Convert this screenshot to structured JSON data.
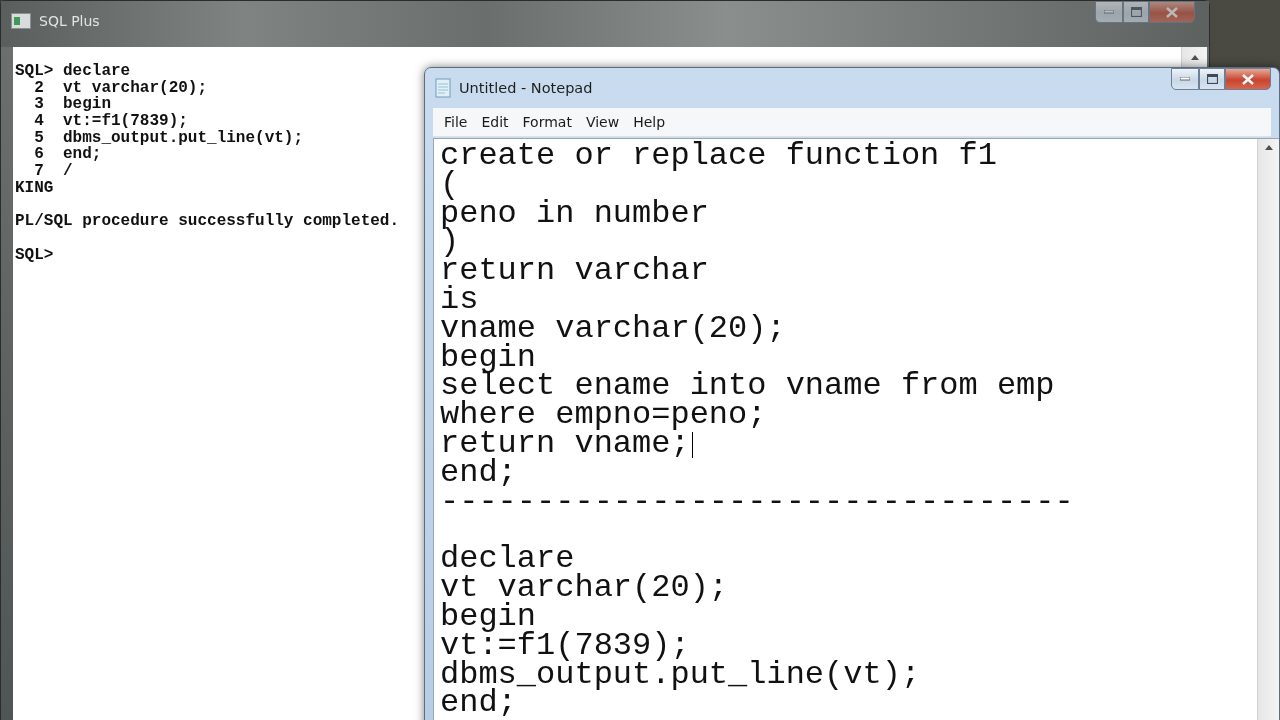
{
  "sqlplus_window": {
    "title": "SQL Plus",
    "lines": [
      {
        "kind": "text",
        "text": "SQL> declare"
      },
      {
        "kind": "text",
        "text": "  2  vt varchar(20);"
      },
      {
        "kind": "text",
        "text": "  3  begin"
      },
      {
        "kind": "text",
        "text": "  4  vt:=f1(7839);"
      },
      {
        "kind": "text",
        "text": "  5  dbms_output.put_line(vt);"
      },
      {
        "kind": "text",
        "text": "  6  end;"
      },
      {
        "kind": "text",
        "text": "  7  /"
      },
      {
        "kind": "text",
        "text": "KING"
      },
      {
        "kind": "blank"
      },
      {
        "kind": "text",
        "text": "PL/SQL procedure successfully completed."
      },
      {
        "kind": "blank"
      },
      {
        "kind": "text",
        "text": "SQL>"
      }
    ]
  },
  "notepad_window": {
    "title": "Untitled - Notepad",
    "menu": [
      "File",
      "Edit",
      "Format",
      "View",
      "Help"
    ],
    "lines": [
      {
        "kind": "text",
        "text": "create or replace function f1",
        "caret": false
      },
      {
        "kind": "text",
        "text": "(",
        "caret": false
      },
      {
        "kind": "text",
        "text": "peno in number",
        "caret": false
      },
      {
        "kind": "text",
        "text": ")",
        "caret": false
      },
      {
        "kind": "text",
        "text": "return varchar",
        "caret": false
      },
      {
        "kind": "text",
        "text": "is",
        "caret": false
      },
      {
        "kind": "text",
        "text": "vname varchar(20);",
        "caret": false
      },
      {
        "kind": "text",
        "text": "begin",
        "caret": false
      },
      {
        "kind": "text",
        "text": "select ename into vname from emp",
        "caret": false
      },
      {
        "kind": "text",
        "text": "where empno=peno;",
        "caret": false
      },
      {
        "kind": "text",
        "text": "return vname;",
        "caret": true
      },
      {
        "kind": "text",
        "text": "end;",
        "caret": false
      },
      {
        "kind": "text",
        "text": "---------------------------------",
        "caret": false
      },
      {
        "kind": "blank",
        "caret": false
      },
      {
        "kind": "text",
        "text": "declare",
        "caret": false
      },
      {
        "kind": "text",
        "text": "vt varchar(20);",
        "caret": false
      },
      {
        "kind": "text",
        "text": "begin",
        "caret": false
      },
      {
        "kind": "text",
        "text": "vt:=f1(7839);",
        "caret": false
      },
      {
        "kind": "text",
        "text": "dbms_output.put_line(vt);",
        "caret": false
      },
      {
        "kind": "text",
        "text": "end;",
        "caret": false
      }
    ]
  }
}
